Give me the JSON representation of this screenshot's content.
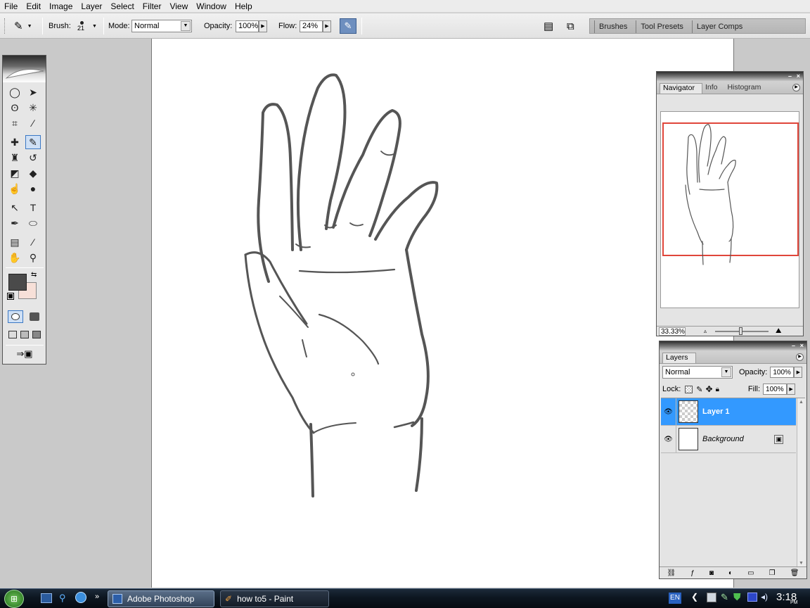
{
  "menubar": {
    "items": [
      "File",
      "Edit",
      "Image",
      "Layer",
      "Select",
      "Filter",
      "View",
      "Window",
      "Help"
    ]
  },
  "options": {
    "brush_label": "Brush:",
    "brush_size": "21",
    "mode_label": "Mode:",
    "mode_value": "Normal",
    "opacity_label": "Opacity:",
    "opacity_value": "100%",
    "flow_label": "Flow:",
    "flow_value": "24%",
    "well_tabs": [
      "Brushes",
      "Tool Presets",
      "Layer Comps"
    ]
  },
  "toolbox": {
    "foreground_color": "#4a4a4a",
    "background_color": "#f7e0d8",
    "tools": [
      {
        "name": "elliptical-marquee-icon",
        "glyph": "◯"
      },
      {
        "name": "move-icon",
        "glyph": "➤"
      },
      {
        "name": "lasso-icon",
        "glyph": "ʘ"
      },
      {
        "name": "magic-wand-icon",
        "glyph": "✳"
      },
      {
        "name": "crop-icon",
        "glyph": "⌗"
      },
      {
        "name": "slice-icon",
        "glyph": "∕"
      },
      {
        "name": "healing-brush-icon",
        "glyph": "✚"
      },
      {
        "name": "brush-icon",
        "glyph": "✎"
      },
      {
        "name": "clone-stamp-icon",
        "glyph": "♜"
      },
      {
        "name": "history-brush-icon",
        "glyph": "↺"
      },
      {
        "name": "eraser-icon",
        "glyph": "◩"
      },
      {
        "name": "paint-bucket-icon",
        "glyph": "◆"
      },
      {
        "name": "smudge-icon",
        "glyph": "☝"
      },
      {
        "name": "dodge-icon",
        "glyph": "●"
      },
      {
        "name": "path-select-icon",
        "glyph": "↖"
      },
      {
        "name": "type-icon",
        "glyph": "T"
      },
      {
        "name": "pen-icon",
        "glyph": "✒"
      },
      {
        "name": "shape-icon",
        "glyph": "⬭"
      },
      {
        "name": "notes-icon",
        "glyph": "▤"
      },
      {
        "name": "eyedropper-icon",
        "glyph": "⁄"
      },
      {
        "name": "hand-icon",
        "glyph": "✋"
      },
      {
        "name": "zoom-icon",
        "glyph": "⚲"
      }
    ]
  },
  "navigator": {
    "tabs": [
      "Navigator",
      "Info",
      "Histogram"
    ],
    "zoom": "33.33%",
    "view_box_color": "#e0463a"
  },
  "layers": {
    "tab": "Layers",
    "blend_mode": "Normal",
    "opacity_label": "Opacity:",
    "opacity_value": "100%",
    "lock_label": "Lock:",
    "fill_label": "Fill:",
    "fill_value": "100%",
    "rows": [
      {
        "name": "Layer 1",
        "selected": true
      },
      {
        "name": "Background",
        "selected": false
      }
    ],
    "selection_color": "#3399ff"
  },
  "taskbar": {
    "tasks": [
      "Adobe Photoshop",
      "how to5 - Paint"
    ],
    "language": "EN",
    "clock": "3:18",
    "clock_ampm": "PM"
  }
}
